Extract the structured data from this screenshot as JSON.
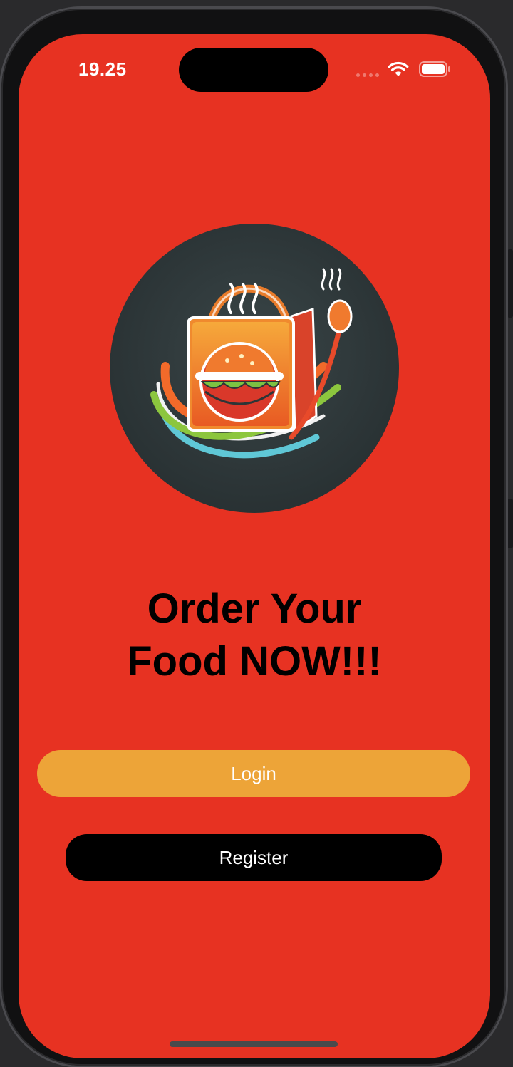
{
  "status_bar": {
    "time": "19.25",
    "icons": [
      "signal-dots-icon",
      "wifi-icon",
      "battery-icon"
    ]
  },
  "logo": {
    "icon": "food-delivery-bag-logo"
  },
  "headline": {
    "line1": "Order Your",
    "line2": "Food NOW!!!"
  },
  "actions": {
    "login_label": "Login",
    "register_label": "Register"
  },
  "colors": {
    "background": "#e73222",
    "login_button": "#eda438",
    "register_button": "#000000",
    "headline_text": "#000000",
    "button_text": "#ffffff"
  }
}
